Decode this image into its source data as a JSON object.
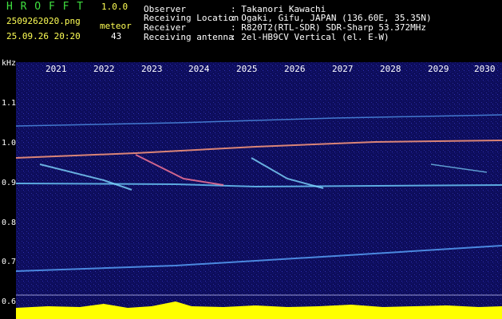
{
  "app": {
    "title": "H R O F F T",
    "version": "1.0.0",
    "filename": "2509262020.png",
    "datetime": "25.09.26 20:20",
    "counter_label": "meteor",
    "counter_value": "43"
  },
  "info": {
    "rows": [
      {
        "key": "Observer",
        "value": ": Takanori Kawachi"
      },
      {
        "key": "Receiving Location",
        "value": ": Ogaki, Gifu, JAPAN (136.60E, 35.35N)"
      },
      {
        "key": "Receiver",
        "value": ": R820T2(RTL-SDR) SDR-Sharp 53.372MHz"
      },
      {
        "key": "Receiving antenna",
        "value": ": 2el-HB9CV Vertical (el. E-W)"
      }
    ]
  },
  "axes": {
    "unit": "kHz",
    "years": [
      "2021",
      "2022",
      "2023",
      "2024",
      "2025",
      "2026",
      "2027",
      "2028",
      "2029",
      "2030"
    ],
    "freq_ticks": [
      "1.1",
      "1.0",
      "0.9",
      "0.8",
      "0.7",
      "0.6"
    ]
  },
  "colors": {
    "background": "#000000",
    "spectrogram": "#0d0d5c",
    "title_green": "#3fe03f",
    "label_yellow": "#ffff55",
    "signal_cyan": "#5aa8ff",
    "activity_yellow": "#ffff00",
    "activity_cyan": "#00c8ff"
  }
}
